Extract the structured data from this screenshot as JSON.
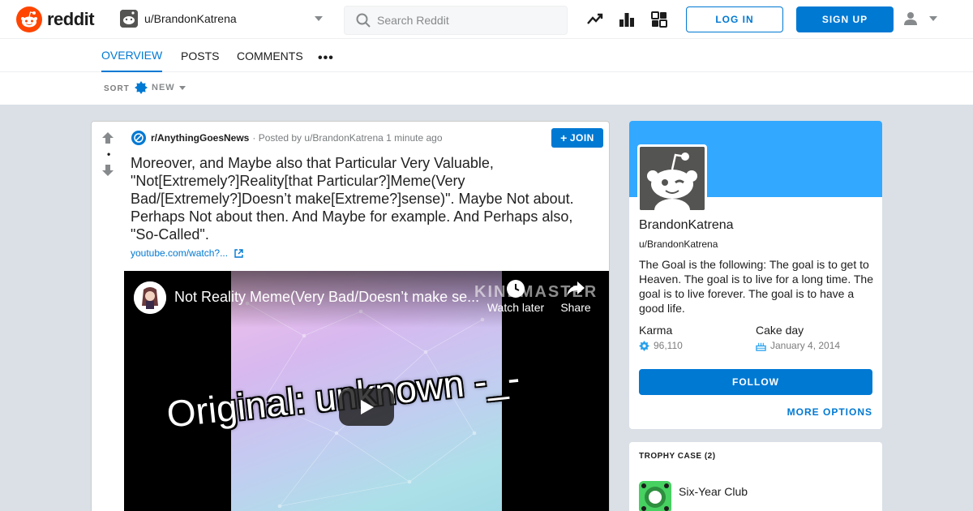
{
  "colors": {
    "brand": "#ff4500",
    "accent": "#0079d3",
    "banner": "#33a8ff"
  },
  "header": {
    "logo_text": "reddit",
    "user_switch_name": "u/BrandonKatrena",
    "search_placeholder": "Search Reddit",
    "icons": [
      "trending-icon",
      "leaderboard-icon",
      "coins-icon"
    ],
    "login_label": "LOG IN",
    "signup_label": "SIGN UP"
  },
  "tabs": [
    {
      "label": "OVERVIEW",
      "active": true
    },
    {
      "label": "POSTS",
      "active": false
    },
    {
      "label": "COMMENTS",
      "active": false
    }
  ],
  "tab_more": "•••",
  "sort": {
    "label": "SORT",
    "value": "NEW"
  },
  "post": {
    "score": "•",
    "subreddit": "r/AnythingGoesNews",
    "posted_by": "· Posted by u/BrandonKatrena 1 minute ago",
    "join_label": "JOIN",
    "title": "Moreover, and Maybe also that Particular Very Valuable, \"Not[Extremely?]Reality[that Particular?]Meme(Very Bad/[Extremely?]Doesn’t make[Extreme?]sense)\". Maybe Not about. Perhaps Not about then. And Maybe for example. And Perhaps also, \"So-Called\".",
    "link_text": "youtube.com/watch?...",
    "video": {
      "title": "Not Reality Meme(Very Bad/Doesn’t make se...",
      "watermark": "KINEMASTER",
      "watch_later_label": "Watch later",
      "share_label": "Share",
      "overlay_text": "Original: unknown -_-"
    }
  },
  "profile": {
    "display_name": "BrandonKatrena",
    "handle": "u/BrandonKatrena",
    "bio": "The Goal is the following: The goal is to get to Heaven. The goal is to live for a long time. The goal is to live forever. The goal is to have a good life.",
    "karma_label": "Karma",
    "karma_value": "96,110",
    "cake_label": "Cake day",
    "cake_value": "January 4, 2014",
    "follow_label": "FOLLOW",
    "more_options_label": "MORE OPTIONS"
  },
  "trophy_case": {
    "title": "TROPHY CASE (2)",
    "items": [
      {
        "name": "Six-Year Club"
      }
    ]
  }
}
